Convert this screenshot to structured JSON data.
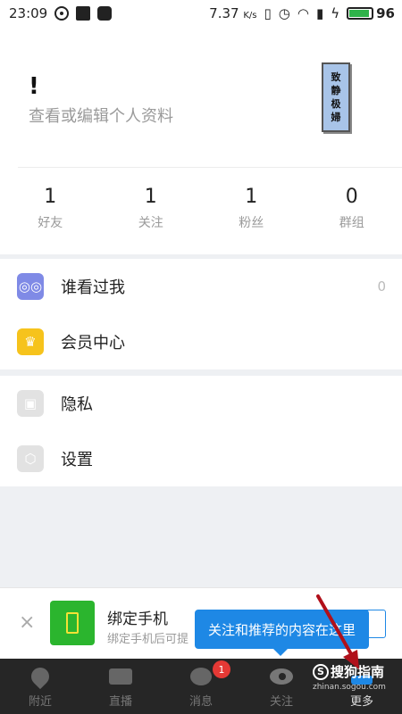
{
  "status_bar": {
    "time": "23:09",
    "speed": "7.37",
    "speed_unit": "K/s",
    "battery": "96"
  },
  "profile": {
    "name": "!",
    "edit_text": "查看或编辑个人资料",
    "avatar_text": [
      "致",
      "静",
      "极",
      "婦"
    ],
    "stats": [
      {
        "value": "1",
        "label": "好友"
      },
      {
        "value": "1",
        "label": "关注"
      },
      {
        "value": "1",
        "label": "粉丝"
      },
      {
        "value": "0",
        "label": "群组"
      }
    ]
  },
  "menu": {
    "section1": [
      {
        "label": "谁看过我",
        "count": "0",
        "icon": "glasses-icon"
      },
      {
        "label": "会员中心",
        "icon": "crown-icon"
      }
    ],
    "section2": [
      {
        "label": "隐私",
        "icon": "lock-icon"
      },
      {
        "label": "设置",
        "icon": "gear-icon"
      }
    ]
  },
  "banner": {
    "title": "绑定手机",
    "subtitle": "绑定手机后可提",
    "close": "×"
  },
  "tooltip": {
    "text": "关注和推荐的内容在这里"
  },
  "bottom_nav": {
    "tabs": [
      {
        "label": "附近",
        "icon": "location-pin-icon"
      },
      {
        "label": "直播",
        "icon": "video-camera-icon"
      },
      {
        "label": "消息",
        "icon": "chat-bubble-icon"
      },
      {
        "label": "关注",
        "icon": "eye-icon"
      },
      {
        "label": "更多",
        "icon": "more-icon"
      }
    ],
    "message_badge": "1"
  },
  "watermark": {
    "main": "搜狗指南",
    "sub": "zhinan.sogou.com"
  },
  "colors": {
    "accent": "#1e88e5",
    "nav_bg": "#262626",
    "badge": "#e53935",
    "phone_green": "#2bb52e",
    "glasses": "#7f8ae6",
    "crown": "#f6c31c"
  }
}
